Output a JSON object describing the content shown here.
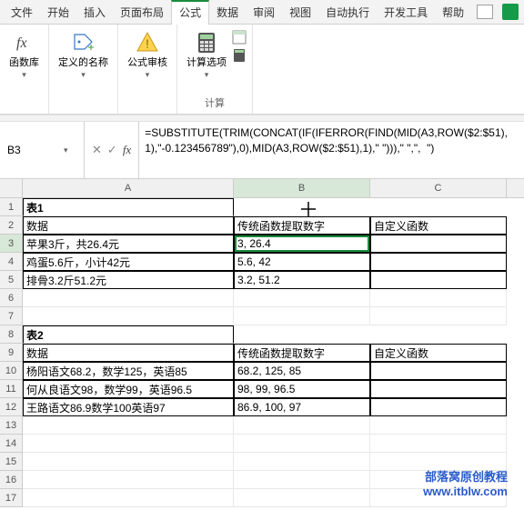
{
  "tabs": {
    "items": [
      "文件",
      "开始",
      "插入",
      "页面布局",
      "公式",
      "数据",
      "审阅",
      "视图",
      "自动执行",
      "开发工具",
      "帮助"
    ],
    "active": 4
  },
  "ribbon": {
    "fxlib": "函数库",
    "defname": "定义的名称",
    "audit": "公式审核",
    "calcopt": "计算选项",
    "calcgroup": "计算"
  },
  "namebox": "B3",
  "formula": "=SUBSTITUTE(TRIM(CONCAT(IF(IFERROR(FIND(MID(A3,ROW($2:$51),1),\"-0.123456789\"),0),MID(A3,ROW($2:$51),1),\" \"))),\" \",\",  \")",
  "cols": [
    "",
    "A",
    "B",
    "C"
  ],
  "rows": [
    {
      "n": 1,
      "cells": [
        {
          "v": "表1",
          "cls": "tblT"
        },
        {
          "v": "",
          "cls": "nob"
        },
        {
          "v": "",
          "cls": "nob"
        }
      ]
    },
    {
      "n": 2,
      "cells": [
        {
          "v": "数据",
          "cls": "tbl"
        },
        {
          "v": "传统函数提取数字",
          "cls": "tbl"
        },
        {
          "v": "自定义函数",
          "cls": "tbl"
        }
      ]
    },
    {
      "n": 3,
      "sel": true,
      "cells": [
        {
          "v": "苹果3斤，共26.4元",
          "cls": "tbl"
        },
        {
          "v": "3,  26.4",
          "cls": "tbl",
          "active": true
        },
        {
          "v": "",
          "cls": "tbl"
        }
      ]
    },
    {
      "n": 4,
      "cells": [
        {
          "v": "鸡蛋5.6斤，小计42元",
          "cls": "tbl"
        },
        {
          "v": "5.6,  42",
          "cls": "tbl"
        },
        {
          "v": "",
          "cls": "tbl"
        }
      ]
    },
    {
      "n": 5,
      "cells": [
        {
          "v": "排骨3.2斤51.2元",
          "cls": "tbl"
        },
        {
          "v": "3.2,  51.2",
          "cls": "tbl"
        },
        {
          "v": "",
          "cls": "tbl"
        }
      ]
    },
    {
      "n": 6,
      "cells": [
        {
          "v": ""
        },
        {
          "v": ""
        },
        {
          "v": ""
        }
      ]
    },
    {
      "n": 7,
      "cells": [
        {
          "v": ""
        },
        {
          "v": ""
        },
        {
          "v": ""
        }
      ]
    },
    {
      "n": 8,
      "cells": [
        {
          "v": "表2",
          "cls": "tblT"
        },
        {
          "v": "",
          "cls": "nob"
        },
        {
          "v": "",
          "cls": "nob"
        }
      ]
    },
    {
      "n": 9,
      "cells": [
        {
          "v": "数据",
          "cls": "tbl"
        },
        {
          "v": "传统函数提取数字",
          "cls": "tbl"
        },
        {
          "v": "自定义函数",
          "cls": "tbl"
        }
      ]
    },
    {
      "n": 10,
      "cells": [
        {
          "v": "杨阳语文68.2，数学125，英语85",
          "cls": "tbl"
        },
        {
          "v": "68.2,  125,  85",
          "cls": "tbl"
        },
        {
          "v": "",
          "cls": "tbl"
        }
      ]
    },
    {
      "n": 11,
      "cells": [
        {
          "v": "何从良语文98，数学99，英语96.5",
          "cls": "tbl"
        },
        {
          "v": "98,  99,  96.5",
          "cls": "tbl"
        },
        {
          "v": "",
          "cls": "tbl"
        }
      ]
    },
    {
      "n": 12,
      "cells": [
        {
          "v": "王路语文86.9数学100英语97",
          "cls": "tbl"
        },
        {
          "v": "86.9,  100,  97",
          "cls": "tbl"
        },
        {
          "v": "",
          "cls": "tbl"
        }
      ]
    },
    {
      "n": 13,
      "cells": [
        {
          "v": ""
        },
        {
          "v": ""
        },
        {
          "v": ""
        }
      ]
    },
    {
      "n": 14,
      "cells": [
        {
          "v": ""
        },
        {
          "v": ""
        },
        {
          "v": ""
        }
      ]
    },
    {
      "n": 15,
      "cells": [
        {
          "v": ""
        },
        {
          "v": ""
        },
        {
          "v": ""
        }
      ]
    },
    {
      "n": 16,
      "cells": [
        {
          "v": ""
        },
        {
          "v": ""
        },
        {
          "v": ""
        }
      ]
    },
    {
      "n": 17,
      "cells": [
        {
          "v": ""
        },
        {
          "v": ""
        },
        {
          "v": ""
        }
      ]
    }
  ],
  "selectedCol": 2,
  "watermark": {
    "t": "部落窝原创教程",
    "u": "www.itblw.com"
  }
}
